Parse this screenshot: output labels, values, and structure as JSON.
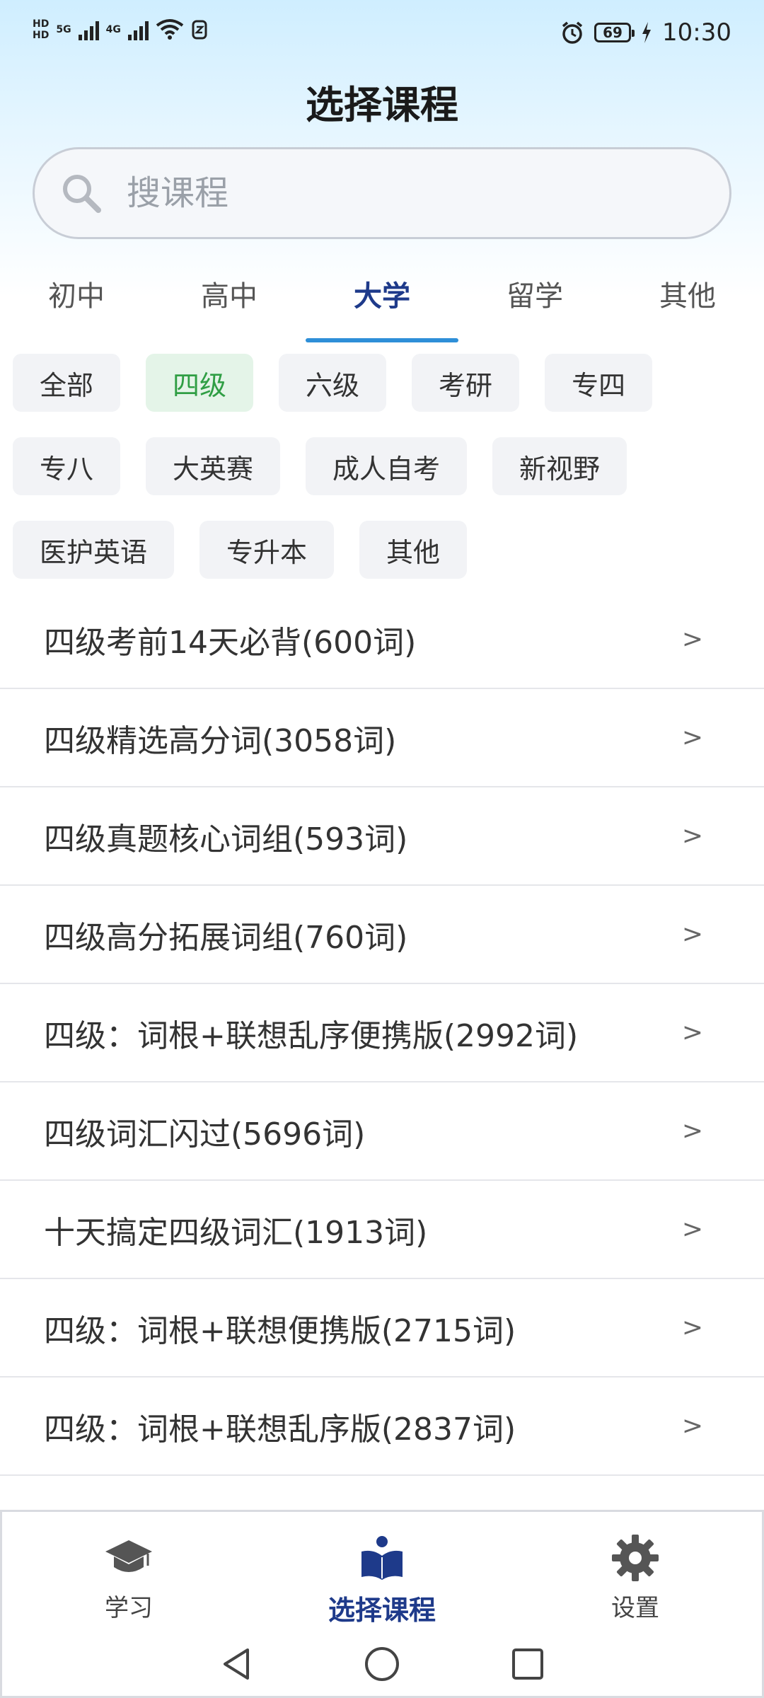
{
  "status_bar": {
    "net_hd_top": "HD",
    "net_hd_bottom": "HD",
    "net_5g": "5G",
    "net_4g": "4G",
    "battery": "69",
    "time": "10:30"
  },
  "header": {
    "title": "选择课程"
  },
  "search": {
    "placeholder": "搜课程",
    "value": ""
  },
  "tabs": [
    {
      "label": "初中"
    },
    {
      "label": "高中"
    },
    {
      "label": "大学",
      "active": true
    },
    {
      "label": "留学"
    },
    {
      "label": "其他"
    }
  ],
  "chips": {
    "row1": [
      "全部",
      "四级",
      "六级",
      "考研",
      "专四"
    ],
    "row2": [
      "专八",
      "大英赛",
      "成人自考",
      "新视野"
    ],
    "row3": [
      "医护英语",
      "专升本",
      "其他"
    ],
    "selected": "四级"
  },
  "courses": [
    {
      "title": "四级考前14天必背(600词)",
      "arrow": ">"
    },
    {
      "title": "四级精选高分词(3058词)",
      "arrow": ">"
    },
    {
      "title": "四级真题核心词组(593词)",
      "arrow": ">"
    },
    {
      "title": "四级高分拓展词组(760词)",
      "arrow": ">"
    },
    {
      "title": "四级：词根+联想乱序便携版(2992词)",
      "arrow": ">"
    },
    {
      "title": "四级词汇闪过(5696词)",
      "arrow": ">"
    },
    {
      "title": "十天搞定四级词汇(1913词)",
      "arrow": ">"
    },
    {
      "title": "四级：词根+联想便携版(2715词)",
      "arrow": ">"
    },
    {
      "title": "四级：词根+联想乱序版(2837词)",
      "arrow": ">"
    }
  ],
  "bottom_nav": {
    "study": "学习",
    "select_course": "选择课程",
    "settings": "设置"
  },
  "colors": {
    "accent": "#1e3a8a",
    "tab_indicator": "#2e8fd8",
    "chip_selected_text": "#2f9e44",
    "chip_selected_bg": "#e4f4e8"
  },
  "icons": {
    "study": "graduation-cap-icon",
    "select_course": "reading-book-icon",
    "settings": "gear-icon",
    "search": "search-icon",
    "back": "back-triangle-icon",
    "home": "home-circle-icon",
    "recents": "recents-square-icon"
  }
}
